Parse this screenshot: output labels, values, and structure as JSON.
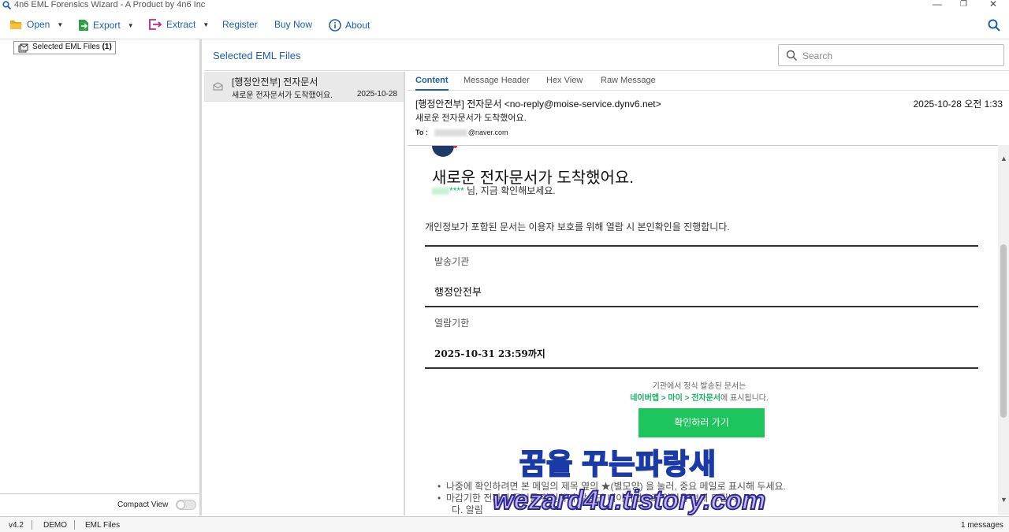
{
  "window": {
    "title": "4n6 EML Forensics Wizard - A Product by 4n6 Inc",
    "controls": [
      "—",
      "❐",
      "✕"
    ]
  },
  "toolbar": {
    "open": "Open",
    "export": "Export",
    "extract": "Extract",
    "register": "Register",
    "buy_now": "Buy Now",
    "about": "About"
  },
  "tree": {
    "root_label": "Selected EML Files",
    "root_count": "(1)"
  },
  "compact_view": {
    "label": "Compact View",
    "enabled": false
  },
  "list_header": {
    "title": "Selected EML Files",
    "search_placeholder": "Search"
  },
  "messages": [
    {
      "subject": "[행정안전부] 전자문서",
      "preview": "새로운 전자문서가 도착했어요.",
      "date": "2025-10-28"
    }
  ],
  "tabs": [
    "Content",
    "Message Header",
    "Hex View",
    "Raw Message"
  ],
  "active_tab": "Content",
  "message": {
    "from": "[행정안전부] 전자문서 <no-reply@moise-service.dynv6.net>",
    "datetime": "2025-10-28 오전 1:33",
    "subject": "새로운 전자문서가 도착했어요.",
    "to_label": "To :",
    "to_visible": "@naver.com"
  },
  "email_body": {
    "heading": "새로운 전자문서가 도착했어요.",
    "greeting_stars": "****",
    "greeting_rest": " 님, 지금 확인해보세요.",
    "notice": "개인정보가 포함된 문서는 이용자 보호를 위해 열람 시 본인확인을 진행합니다.",
    "sender_label": "발송기관",
    "sender_value": "행정안전부",
    "deadline_label": "열람기한",
    "deadline_value": "2025-10-31 23:59까지",
    "footer_line1": "기관에서 정식 발송된 문서는",
    "footer_path": "네이버앱 > 마이 > 전자문서",
    "footer_line2_rest": "에 표시됩니다.",
    "button": "확인하러 가기",
    "bullet1": "나중에 확인하려면 본 메일의 제목 옆의 ★(별모양) 을 눌러, 중요 메일로 표시해 두세요.",
    "bullet2": "마감기한 전까지 문서를 확인하지 않으면 네이버앱으로 알림을 보내 드립니",
    "bullet3": "다. 알림"
  },
  "watermarks": {
    "korean": "꿈을 꾸는파랑새",
    "url": "wezard4u.tistory.com"
  },
  "statusbar": {
    "version": "v4.2",
    "mode": "DEMO",
    "type": "EML Files",
    "count": "1 messages"
  }
}
